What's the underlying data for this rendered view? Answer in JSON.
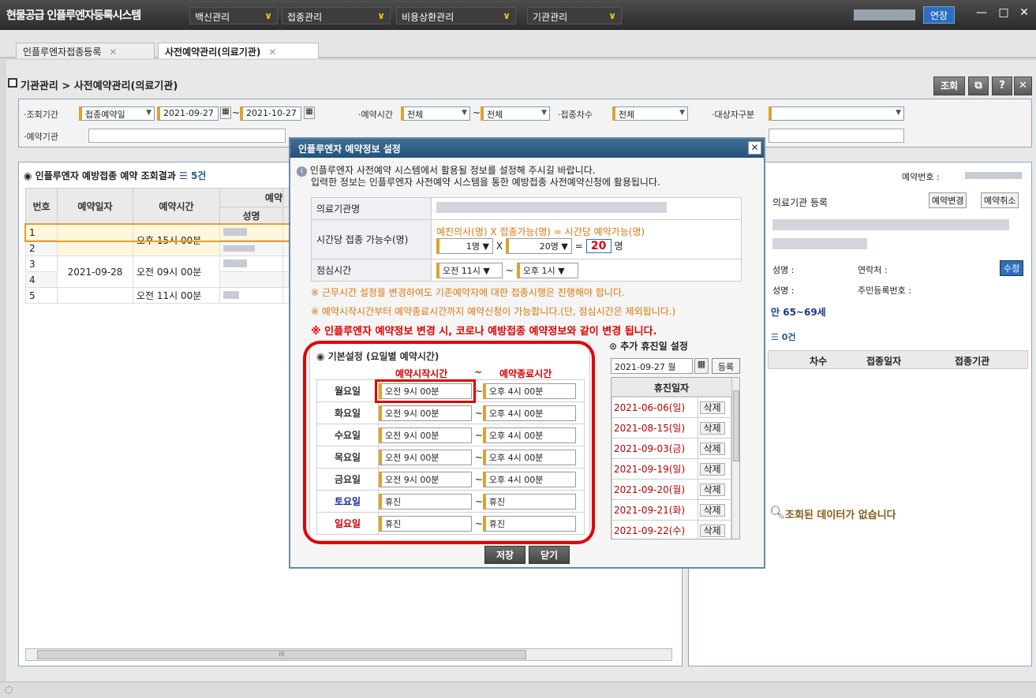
{
  "app": {
    "title": "현물공급 인플루엔자등록시스템"
  },
  "menus": [
    {
      "label": "백신관리"
    },
    {
      "label": "접종관리"
    },
    {
      "label": "비용상환관리"
    },
    {
      "label": "기관관리"
    }
  ],
  "topright": {
    "extend_label": "연장",
    "minimize": "—",
    "maximize": "□",
    "close": "✕"
  },
  "tabs": [
    {
      "label": "인플루엔자접종등록"
    },
    {
      "label": "사전예약관리(의료기관)"
    }
  ],
  "breadcrumb": "기관관리 > 사전예약관리(의료기관)",
  "search_label": "조회",
  "filters": {
    "period_label": "·조회기간",
    "period_type": "접종예약일",
    "date_from": "2021-09-27",
    "date_to": "2021-10-27",
    "time_label": "·예약시간",
    "time_from": "전체",
    "time_to": "전체",
    "dose_label": "·접종차수",
    "dose": "전체",
    "target_label": "·대상자구분",
    "org_label": "·예약기관"
  },
  "left_panel": {
    "title": "인플루엔자 예방접종 예약 조회결과",
    "count": "5건",
    "col_no": "번호",
    "col_date": "예약일자",
    "col_time": "예약시간",
    "col_name": "성명",
    "group_label": "예약",
    "rows": [
      {
        "no": "1",
        "date": "",
        "time": "오후 15시 00분"
      },
      {
        "no": "2",
        "date": "",
        "time": ""
      },
      {
        "no": "3",
        "date": "2021-09-28",
        "time": "오전 09시 00분"
      },
      {
        "no": "4",
        "date": "",
        "time": ""
      },
      {
        "no": "5",
        "date": "",
        "time": "오전 11시 00분"
      }
    ],
    "scroll_mark": "III"
  },
  "right_panel": {
    "reserve_no_label": "예약번호 :",
    "org_register": "의료기관 등록",
    "btn_change": "예약변경",
    "btn_cancel": "예약취소",
    "name_label": "성명 :",
    "contact_label": "연락처 :",
    "edit_btn": "수정",
    "name_label2": "성명 :",
    "rrn_label": "주민등록번호 :",
    "age": "만 65~69세",
    "hist_count": "0건",
    "col_dose": "차수",
    "col_vdate": "접종일자",
    "col_vorg": "접종기관",
    "empty_msg": "조회된 데이터가 없습니다"
  },
  "modal": {
    "title": "인플루엔자 예약정보 설정",
    "info_line1": "인플루엔자 사전예약 시스템에서 활용될 정보를 설정해 주시길 바랍니다.",
    "info_line2": "입력한 정보는 인플루엔자 사전예약 시스템을 통한 예방접종 사전예약신청에 활용됩니다.",
    "org_name_label": "의료기관명",
    "capacity_label": "시간당 접종 가능수(명)",
    "formula": "예진의사(명) X 접종가능(명) = 시간당 예약가능(명)",
    "doctors": "1명",
    "per_doctor": "20명",
    "total": "20",
    "unit": "명",
    "lunch_label": "점심시간",
    "lunch_from": "오전 11시",
    "lunch_to": "오후 1시",
    "note1": "※ 근무시간 설정을 변경하여도 기존예약자에 대한 접종시행은 진행해야 합니다.",
    "note2": "※ 예약시작시간부터 예약종료시간까지 예약신청이 가능합니다.(단, 점심시간은 제외됩니다.)",
    "note3": "※ 인플루엔자 예약정보 변경 시, 코로나 예방접종 예약정보와 같이 변경 됩니다.",
    "basic_title": "기본설정 (요일별 예약시간)",
    "start_hdr": "예약시작시간",
    "tilde": "~",
    "end_hdr": "예약종료시간",
    "days": [
      {
        "day": "월요일",
        "start": "오전 9시 00분",
        "end": "오후 4시 00분",
        "color": "#333333"
      },
      {
        "day": "화요일",
        "start": "오전 9시 00분",
        "end": "오후 4시 00분",
        "color": "#333333"
      },
      {
        "day": "수요일",
        "start": "오전 9시 00분",
        "end": "오후 4시 00분",
        "color": "#333333"
      },
      {
        "day": "목요일",
        "start": "오전 9시 00분",
        "end": "오후 4시 00분",
        "color": "#333333"
      },
      {
        "day": "금요일",
        "start": "오전 9시 00분",
        "end": "오후 4시 00분",
        "color": "#333333"
      },
      {
        "day": "토요일",
        "start": "휴진",
        "end": "휴진",
        "color": "#1a2a9a"
      },
      {
        "day": "일요일",
        "start": "휴진",
        "end": "휴진",
        "color": "#d00000"
      }
    ],
    "holiday_title": "추가 휴진일 설정",
    "holiday_date": "2021-09-27 월",
    "register_btn": "등록",
    "holiday_col": "휴진일자",
    "holidays": [
      {
        "date": "2021-06-06(일)",
        "del": "삭제"
      },
      {
        "date": "2021-08-15(일)",
        "del": "삭제"
      },
      {
        "date": "2021-09-03(금)",
        "del": "삭제"
      },
      {
        "date": "2021-09-19(일)",
        "del": "삭제"
      },
      {
        "date": "2021-09-20(월)",
        "del": "삭제"
      },
      {
        "date": "2021-09-21(화)",
        "del": "삭제"
      },
      {
        "date": "2021-09-22(수)",
        "del": "삭제"
      }
    ],
    "save_btn": "저장",
    "close_btn": "닫기"
  }
}
